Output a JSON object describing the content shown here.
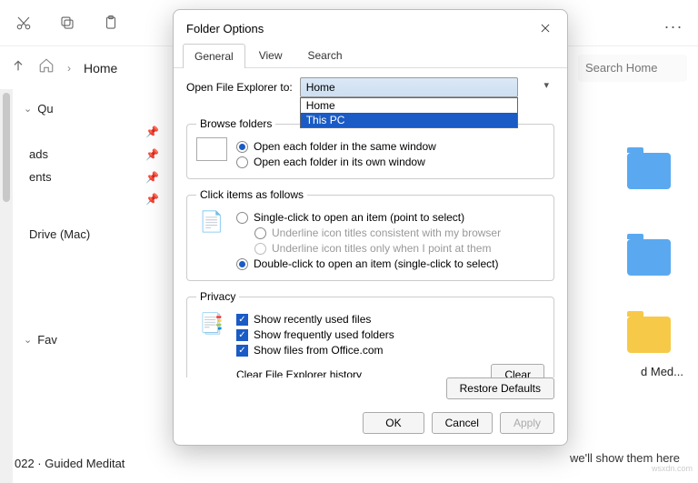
{
  "toolbar": {
    "more": "..."
  },
  "nav": {
    "home_label": "Home",
    "search_placeholder": "Search Home"
  },
  "sidebar": {
    "qu_label": "Qu",
    "fav_label": "Fav",
    "items": [
      "",
      "ads",
      "ents",
      "",
      "Drive (Mac)"
    ],
    "bottom_left": "022 · Guided Meditat"
  },
  "content": {
    "med_label": "d Med...",
    "footer": "we'll show them here"
  },
  "dialog": {
    "title": "Folder Options",
    "tabs": {
      "general": "General",
      "view": "View",
      "search": "Search"
    },
    "open_label": "Open File Explorer to:",
    "combo_value": "Home",
    "dd": {
      "home": "Home",
      "thispc": "This PC"
    },
    "browse": {
      "legend": "Browse folders",
      "same": "Open each folder in the same window",
      "own": "Open each folder in its own window"
    },
    "click": {
      "legend": "Click items as follows",
      "single": "Single-click to open an item (point to select)",
      "u1": "Underline icon titles consistent with my browser",
      "u2": "Underline icon titles only when I point at them",
      "double": "Double-click to open an item (single-click to select)"
    },
    "privacy": {
      "legend": "Privacy",
      "recent": "Show recently used files",
      "freq": "Show frequently used folders",
      "office": "Show files from Office.com",
      "clear_label": "Clear File Explorer history",
      "clear_btn": "Clear"
    },
    "restore": "Restore Defaults",
    "ok": "OK",
    "cancel": "Cancel",
    "apply": "Apply"
  },
  "watermark": "wsxdn.com"
}
